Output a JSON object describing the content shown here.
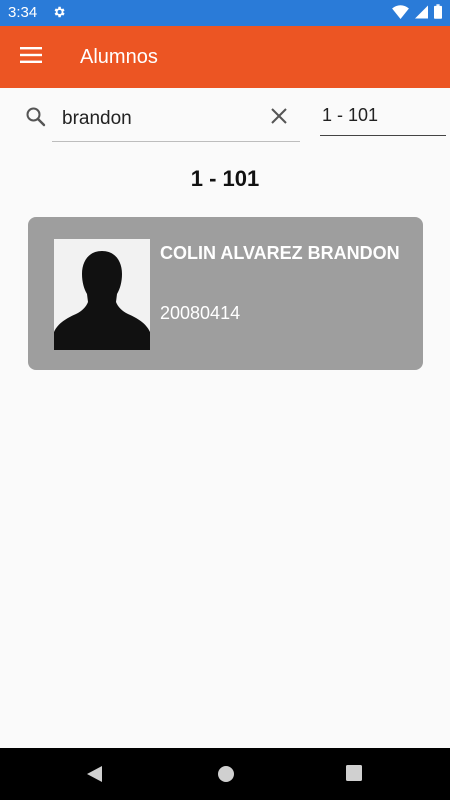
{
  "status_bar": {
    "time": "3:34"
  },
  "app_bar": {
    "title": "Alumnos"
  },
  "search": {
    "value": "brandon",
    "range_value": "1 - 101"
  },
  "heading": "1 - 101",
  "students": [
    {
      "name": "COLIN ALVAREZ BRANDON",
      "id": "20080414"
    }
  ],
  "colors": {
    "status_bar": "#2a7bd8",
    "app_bar": "#ec5523",
    "card": "#9e9e9e"
  }
}
